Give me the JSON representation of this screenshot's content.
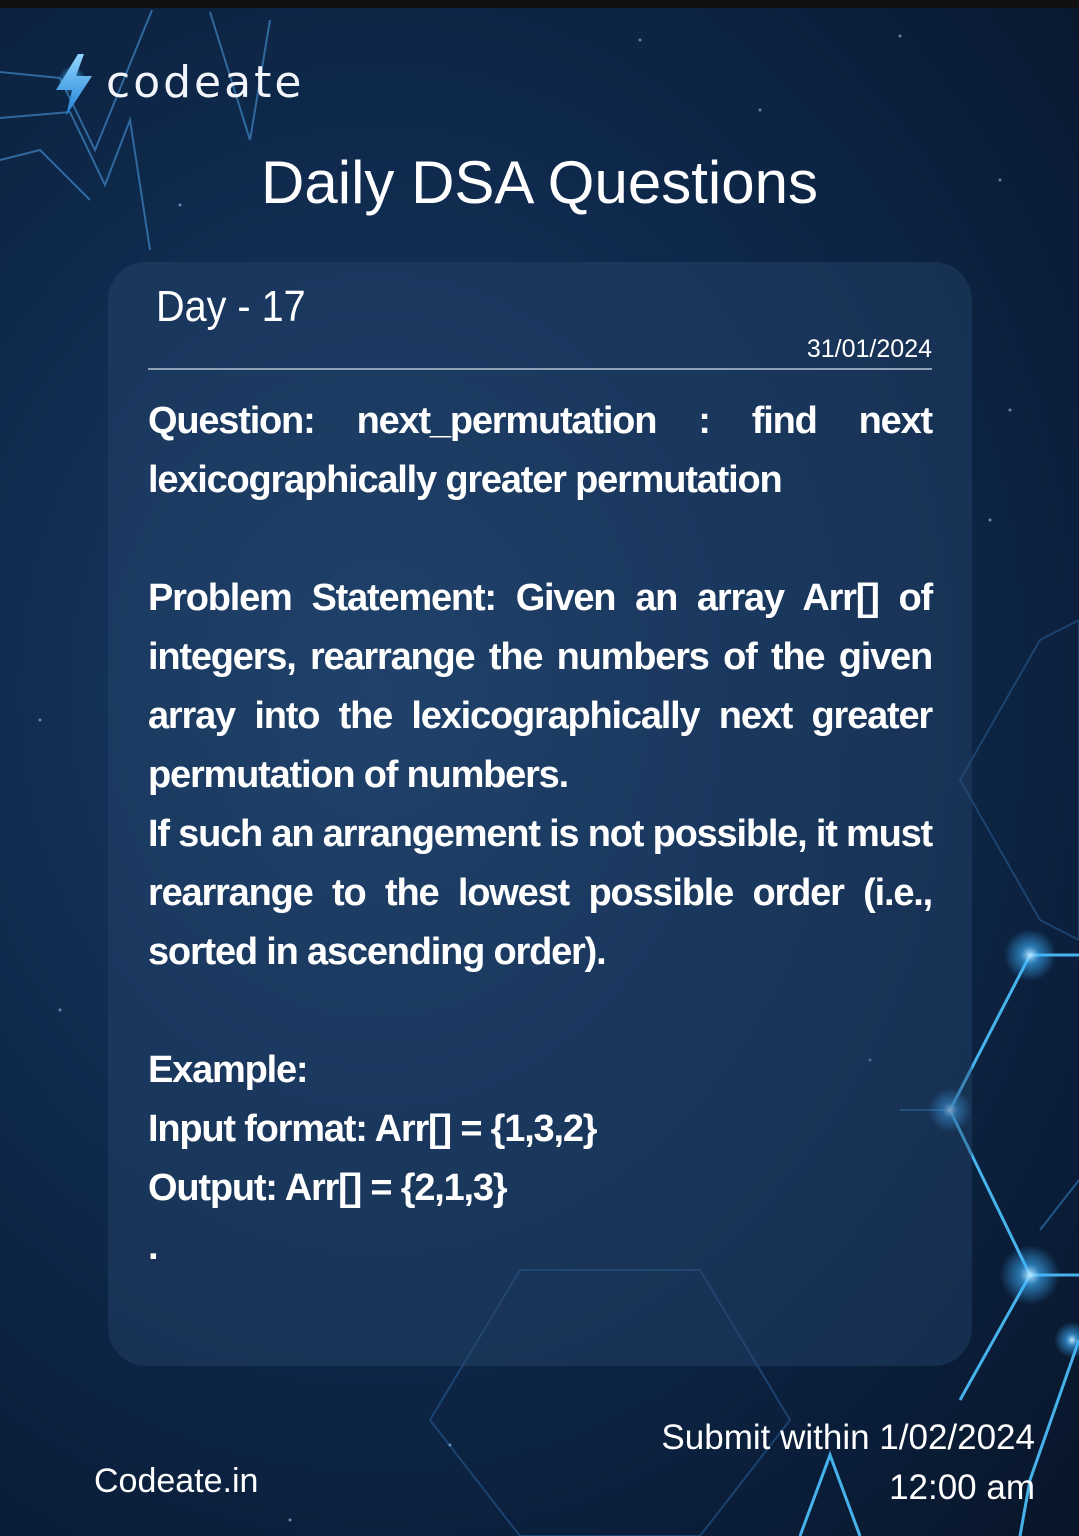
{
  "brand": {
    "name": "codeate",
    "icon": "lightning-bolt-icon"
  },
  "title": "Daily DSA Questions",
  "card": {
    "day": "Day - 17",
    "date": "31/01/2024",
    "question": "Question: next_permutation : find next lexicographically greater permutation",
    "problem_statement": "Problem Statement: Given an array Arr[] of integers, rearrange the numbers of the given array into the lexicographically next greater permutation of numbers.",
    "condition": "If such an arrangement is not possible, it must rearrange to the lowest possible order (i.e., sorted in ascending order).",
    "example_heading": "Example:",
    "input_format": "Input format: Arr[] = {1,3,2}",
    "output": "Output: Arr[] = {2,1,3}",
    "trailing_mark": "."
  },
  "footer": {
    "website": "Codeate.in",
    "submit_line1": "Submit within 1/02/2024",
    "submit_line2": "12:00 am"
  },
  "colors": {
    "background": "#0f2a4d",
    "accent_glow": "#3fb3ff",
    "card": "#284870"
  }
}
